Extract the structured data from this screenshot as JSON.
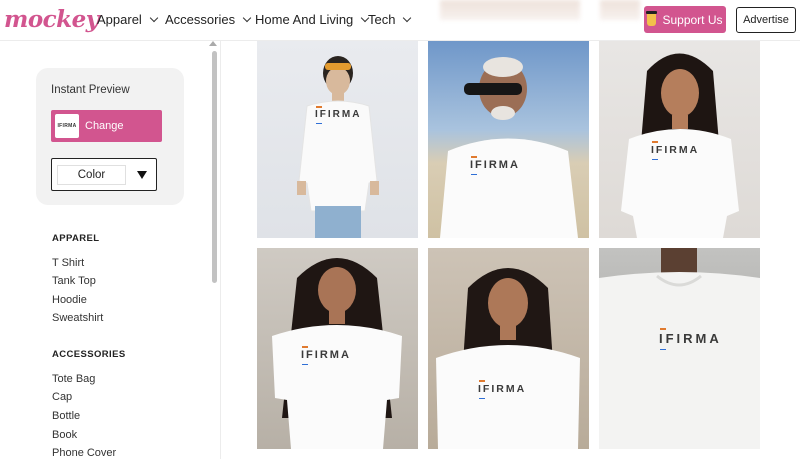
{
  "header": {
    "logo": "mockey",
    "nav": [
      {
        "label": "Apparel"
      },
      {
        "label": "Accessories"
      },
      {
        "label": "Home And Living"
      },
      {
        "label": "Tech"
      }
    ],
    "support_label": "Support Us",
    "advertise_label": "Advertise"
  },
  "sidebar": {
    "preview": {
      "title": "Instant Preview",
      "change_label": "Change",
      "thumb_text": "IFIRMA",
      "color_label": "Color"
    },
    "categories": [
      {
        "heading": "APPAREL",
        "items": [
          "T Shirt",
          "Tank Top",
          "Hoodie",
          "Sweatshirt"
        ]
      },
      {
        "heading": "ACCESSORIES",
        "items": [
          "Tote Bag",
          "Cap",
          "Bottle",
          "Book",
          "Phone Cover"
        ]
      }
    ]
  },
  "gallery": {
    "brand_text": "IFIRMA",
    "accent_colors": [
      "#e07a2f",
      "#2f6fd6"
    ]
  },
  "colors": {
    "brand_pink": "#d2558f",
    "support_cup": "#f2c04b"
  }
}
